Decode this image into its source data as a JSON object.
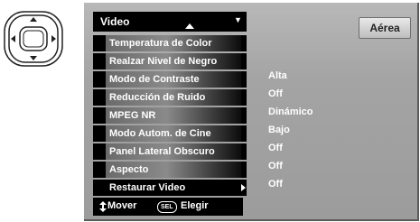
{
  "menu": {
    "title": "Video",
    "items": [
      {
        "label": "Temperatura de Color",
        "value": "Alta"
      },
      {
        "label": "Realzar Nivel de Negro",
        "value": "Off"
      },
      {
        "label": "Modo de Contraste",
        "value": "Dinámico"
      },
      {
        "label": "Reducción de Ruido",
        "value": "Bajo"
      },
      {
        "label": "MPEG NR",
        "value": "Off"
      },
      {
        "label": "Modo Autom. de Cine",
        "value": "Off"
      },
      {
        "label": "Panel Lateral Obscuro",
        "value": "Off"
      },
      {
        "label": "Aspecto",
        "value": ""
      },
      {
        "label": "Restaurar Video",
        "value": ""
      }
    ]
  },
  "input_button": "Aérea",
  "footer": {
    "move_label": "Mover",
    "sel_key": "SEL",
    "select_label": "Elegir"
  },
  "colors": {
    "screen_bg": "#a8a8a8",
    "menu_bg": "#000000",
    "text": "#ffffff"
  },
  "icons": [
    "remote-dpad-icon",
    "up-arrow-icon",
    "dropdown-arrow-icon",
    "submenu-arrow-icon",
    "updown-arrow-icon"
  ]
}
